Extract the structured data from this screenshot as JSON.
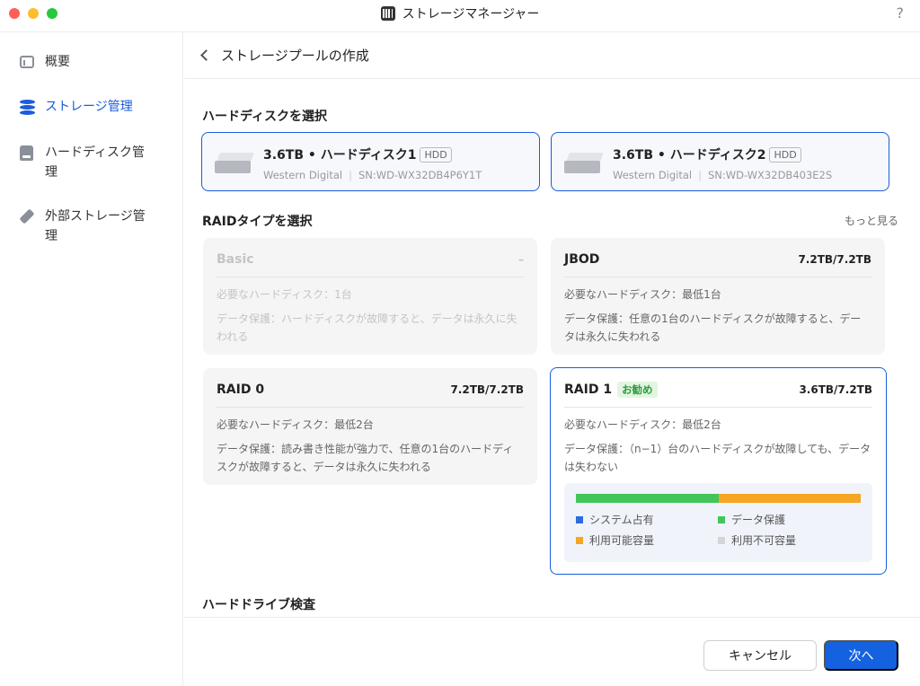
{
  "window": {
    "title": "ストレージマネージャー",
    "help_label": "?"
  },
  "sidebar": {
    "items": [
      {
        "label": "概要",
        "icon": "overview-icon"
      },
      {
        "label": "ストレージ管理",
        "icon": "database-icon"
      },
      {
        "label": "ハードディスク管理",
        "icon": "hard-disk-icon"
      },
      {
        "label": "外部ストレージ管理",
        "icon": "external-storage-icon"
      }
    ]
  },
  "header": {
    "title": "ストレージプールの作成"
  },
  "disk_section": {
    "title": "ハードディスクを選択",
    "disks": [
      {
        "name": "3.6TB • ハードディスク1",
        "tag": "HDD",
        "vendor": "Western Digital",
        "serial": "SN:WD-WX32DB4P6Y1T"
      },
      {
        "name": "3.6TB • ハードディスク2",
        "tag": "HDD",
        "vendor": "Western Digital",
        "serial": "SN:WD-WX32DB403E2S"
      }
    ]
  },
  "raid_section": {
    "title": "RAIDタイプを選択",
    "more_label": "もっと見る",
    "types": [
      {
        "name": "Basic",
        "capacity": "–",
        "required": "必要なハードディスク：1台",
        "protection": "データ保護：ハードディスクが故障すると、データは永久に失われる"
      },
      {
        "name": "JBOD",
        "capacity": "7.2TB/7.2TB",
        "required": "必要なハードディスク：最低1台",
        "protection": "データ保護：任意の1台のハードディスクが故障すると、データは永久に失われる"
      },
      {
        "name": "RAID 0",
        "capacity": "7.2TB/7.2TB",
        "required": "必要なハードディスク：最低2台",
        "protection": "データ保護：読み書き性能が強力で、任意の1台のハードディスクが故障すると、データは永久に失われる"
      },
      {
        "name": "RAID 1",
        "badge": "お勧め",
        "capacity": "3.6TB/7.2TB",
        "required": "必要なハードディスク：最低2台",
        "protection": "データ保護：（n−1）台のハードディスクが故障しても、データは失わない"
      }
    ],
    "capacity_bar": {
      "system_fraction": 0.0,
      "protection_fraction": 0.5,
      "available_fraction": 0.5,
      "unavailable_fraction": 0.0,
      "colors": {
        "system": "#2f6be0",
        "protection": "#43c55a",
        "available": "#f5a623",
        "unavailable": "#d4d4d4"
      }
    },
    "legend": {
      "system": "システム占有",
      "protection": "データ保護",
      "available": "利用可能容量",
      "unavailable": "利用不可容量"
    }
  },
  "drive_check_section": {
    "title": "ハードドライブ検査"
  },
  "footer": {
    "cancel_label": "キャンセル",
    "next_label": "次へ"
  },
  "colors": {
    "accent": "#1a5cdb",
    "primary_button": "#1462e0",
    "recommended": "#2a9d3a"
  }
}
